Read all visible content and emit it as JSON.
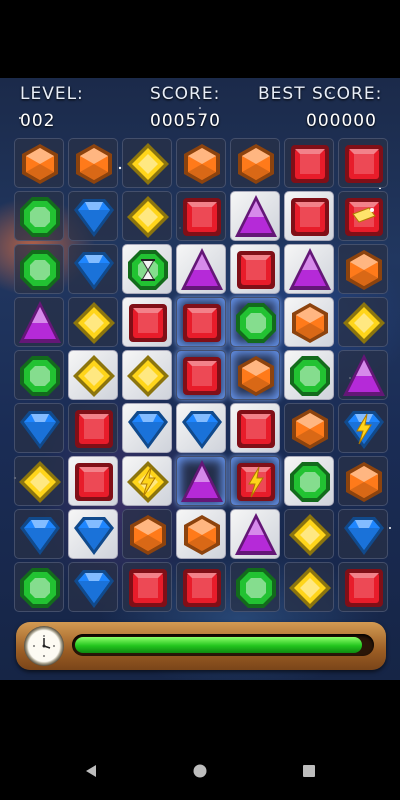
{
  "hud": {
    "level_label": "LEVEL:",
    "level_value": "002",
    "score_label": "SCORE:",
    "score_value": "000570",
    "best_label": "BEST SCORE:",
    "best_value": "000000"
  },
  "timer": {
    "progress": 0.97
  },
  "colors": {
    "orange": "#ff7a1a",
    "yellow": "#ffd51a",
    "red": "#e81c2a",
    "green": "#22c232",
    "blue": "#1e86ff",
    "purple": "#b52ad8"
  },
  "board": {
    "rows": [
      [
        {
          "g": "orange"
        },
        {
          "g": "orange"
        },
        {
          "g": "yellow"
        },
        {
          "g": "orange"
        },
        {
          "g": "orange"
        },
        {
          "g": "red"
        },
        {
          "g": "red"
        }
      ],
      [
        {
          "g": "green"
        },
        {
          "g": "blue"
        },
        {
          "g": "yellow"
        },
        {
          "g": "red"
        },
        {
          "g": "purple",
          "lit": true
        },
        {
          "g": "red",
          "lit": true
        },
        {
          "g": "red",
          "special": "sparkle"
        }
      ],
      [
        {
          "g": "green"
        },
        {
          "g": "blue"
        },
        {
          "g": "green",
          "special": "hourglass",
          "lit": true
        },
        {
          "g": "purple",
          "lit": true
        },
        {
          "g": "red",
          "lit": true
        },
        {
          "g": "purple",
          "lit": true
        },
        {
          "g": "orange"
        }
      ],
      [
        {
          "g": "purple"
        },
        {
          "g": "yellow"
        },
        {
          "g": "red",
          "lit": true
        },
        {
          "g": "red",
          "sel": true
        },
        {
          "g": "green",
          "sel": true
        },
        {
          "g": "orange",
          "lit": true
        },
        {
          "g": "yellow"
        }
      ],
      [
        {
          "g": "green"
        },
        {
          "g": "yellow",
          "lit": true
        },
        {
          "g": "yellow",
          "lit": true
        },
        {
          "g": "red",
          "sel": true
        },
        {
          "g": "orange",
          "sel": true
        },
        {
          "g": "green",
          "lit": true
        },
        {
          "g": "purple"
        }
      ],
      [
        {
          "g": "blue"
        },
        {
          "g": "red"
        },
        {
          "g": "blue",
          "lit": true
        },
        {
          "g": "blue",
          "lit": true
        },
        {
          "g": "red",
          "lit": true
        },
        {
          "g": "orange"
        },
        {
          "g": "blue",
          "special": "lightning"
        }
      ],
      [
        {
          "g": "yellow"
        },
        {
          "g": "red",
          "lit": true
        },
        {
          "g": "yellow",
          "lit": true,
          "special": "lightning"
        },
        {
          "g": "purple",
          "sel": true
        },
        {
          "g": "red",
          "sel": true,
          "special": "lightning"
        },
        {
          "g": "green",
          "lit": true
        },
        {
          "g": "orange"
        }
      ],
      [
        {
          "g": "blue"
        },
        {
          "g": "blue",
          "lit": true
        },
        {
          "g": "orange"
        },
        {
          "g": "orange",
          "lit": true
        },
        {
          "g": "purple",
          "lit": true
        },
        {
          "g": "yellow"
        },
        {
          "g": "blue"
        }
      ],
      [
        {
          "g": "green"
        },
        {
          "g": "blue"
        },
        {
          "g": "red"
        },
        {
          "g": "red"
        },
        {
          "g": "green"
        },
        {
          "g": "yellow"
        },
        {
          "g": "red"
        }
      ]
    ]
  },
  "icons": {
    "clock": "stopwatch-icon",
    "back": "back-triangle-icon",
    "home": "home-circle-icon",
    "recents": "recents-square-icon"
  }
}
